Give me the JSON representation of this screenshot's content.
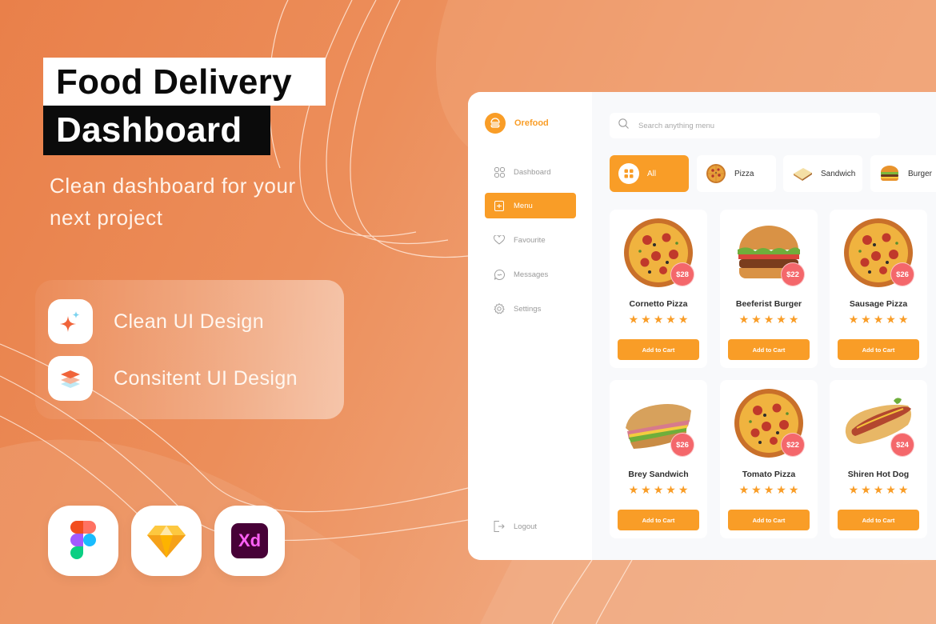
{
  "promo": {
    "title_line_1": "Food Delivery",
    "title_line_2": "Dashboard",
    "subtitle": "Clean dashboard for your next project",
    "features": [
      {
        "icon": "sparkle-icon",
        "label": "Clean UI Design"
      },
      {
        "icon": "layers-icon",
        "label": "Consitent UI Design"
      }
    ],
    "tools": [
      "figma-icon",
      "sketch-icon",
      "adobe-xd-icon"
    ],
    "xd_label": "Xd"
  },
  "dashboard": {
    "brand": {
      "name": "Orefood",
      "icon": "burger-logo-icon"
    },
    "nav": [
      {
        "label": "Dashboard",
        "icon": "grid-icon",
        "active": false
      },
      {
        "label": "Menu",
        "icon": "menu-icon",
        "active": true
      },
      {
        "label": "Favourite",
        "icon": "heart-icon",
        "active": false
      },
      {
        "label": "Messages",
        "icon": "message-icon",
        "active": false
      },
      {
        "label": "Settings",
        "icon": "gear-icon",
        "active": false
      }
    ],
    "logout_label": "Logout",
    "search": {
      "placeholder": "Search anything menu",
      "value": ""
    },
    "categories": [
      {
        "label": "All",
        "icon": "grid-icon",
        "active": true
      },
      {
        "label": "Pizza",
        "icon": "pizza-icon",
        "active": false
      },
      {
        "label": "Sandwich",
        "icon": "sandwich-icon",
        "active": false
      },
      {
        "label": "Burger",
        "icon": "burger-icon",
        "active": false
      }
    ],
    "products": [
      {
        "name": "Cornetto Pizza",
        "price": "$28",
        "rating": 5,
        "image": "pizza",
        "button": "Add to Cart"
      },
      {
        "name": "Beeferist Burger",
        "price": "$22",
        "rating": 5,
        "image": "burger",
        "button": "Add to Cart"
      },
      {
        "name": "Sausage Pizza",
        "price": "$26",
        "rating": 5,
        "image": "pizza",
        "button": "Add to Cart"
      },
      {
        "name": "Brey Sandwich",
        "price": "$26",
        "rating": 5,
        "image": "sandwich",
        "button": "Add to Cart"
      },
      {
        "name": "Tomato Pizza",
        "price": "$22",
        "rating": 5,
        "image": "pizza",
        "button": "Add to Cart"
      },
      {
        "name": "Shiren Hot Dog",
        "price": "$24",
        "rating": 5,
        "image": "hotdog",
        "button": "Add to Cart"
      }
    ]
  },
  "colors": {
    "accent": "#f99d27",
    "price_badge": "#f4676b",
    "background": "#ec8e5a",
    "title_dark": "#0b0b0b"
  }
}
